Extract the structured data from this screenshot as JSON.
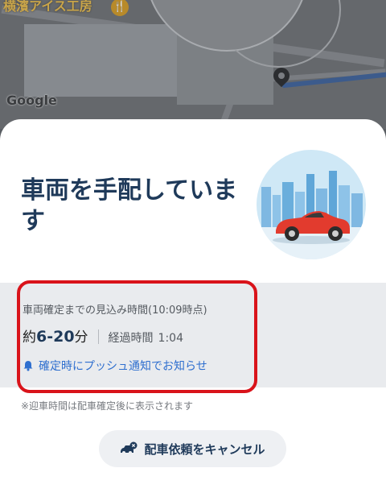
{
  "map": {
    "place_name": "横濱アイス工房",
    "logo_text": "Google"
  },
  "sheet": {
    "title": "車両を手配しています",
    "estimate": {
      "label": "車両確定までの見込み時間(10:09時点)",
      "prefix": "約",
      "value": "6-20",
      "unit": "分",
      "elapsed_label": "経過時間",
      "elapsed_value": "1:04"
    },
    "notify_text": "確定時にプッシュ通知でお知らせ",
    "note": "※迎車時間は配車確定後に表示されます",
    "cancel_label": "配車依頼をキャンセル"
  },
  "colors": {
    "title": "#1f3a5a",
    "accent_blue": "#2f6fcf",
    "highlight_red": "#d9131a",
    "car_red": "#e23b2e"
  },
  "icons": [
    "fork-knife-icon",
    "map-pin-icon",
    "car-illustration",
    "bell-icon",
    "car-cancel-icon"
  ]
}
